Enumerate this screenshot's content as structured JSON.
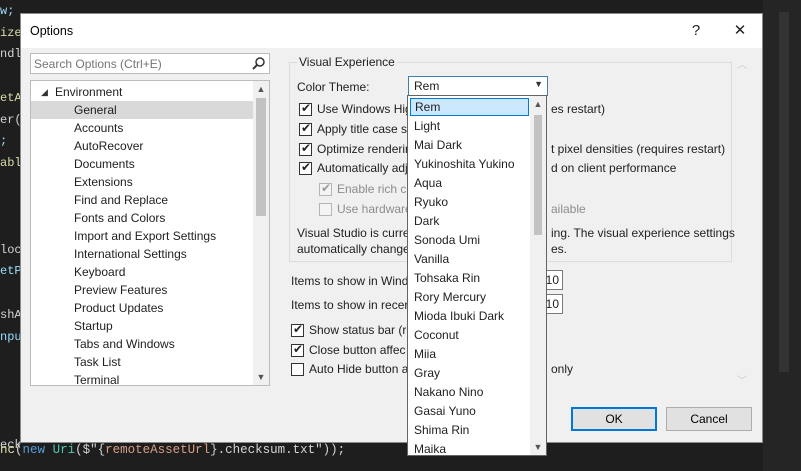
{
  "editor": {
    "left_fragments": [
      "w;",
      "ize",
      "ndl",
      "",
      "etA",
      "er(",
      ";",
      "abl",
      "",
      "",
      "",
      "loc",
      "etP",
      "",
      "shA",
      "npu",
      "",
      "",
      "",
      "",
      "eck"
    ],
    "bottom_line": {
      "fn": "nc",
      "p1": "(",
      "kw": "new",
      "ty": "Uri",
      "p2": "($\"{",
      "st": "remoteAssetUrl",
      "p3": "}.checksum.txt\"));"
    }
  },
  "dialog": {
    "title": "Options",
    "help_label": "?",
    "close_label": "✕",
    "search": {
      "placeholder": "Search Options (Ctrl+E)",
      "value": ""
    },
    "tree": {
      "root": "Environment",
      "items": [
        {
          "label": "General",
          "selected": true
        },
        {
          "label": "Accounts"
        },
        {
          "label": "AutoRecover"
        },
        {
          "label": "Documents"
        },
        {
          "label": "Extensions"
        },
        {
          "label": "Find and Replace"
        },
        {
          "label": "Fonts and Colors"
        },
        {
          "label": "Import and Export Settings"
        },
        {
          "label": "International Settings"
        },
        {
          "label": "Keyboard"
        },
        {
          "label": "Preview Features"
        },
        {
          "label": "Product Updates"
        },
        {
          "label": "Startup"
        },
        {
          "label": "Tabs and Windows"
        },
        {
          "label": "Task List"
        },
        {
          "label": "Terminal"
        }
      ]
    },
    "visual_experience": {
      "group_title": "Visual Experience",
      "color_theme_label": "Color Theme:",
      "color_theme_value": "Rem",
      "checkboxes": [
        {
          "label": "Use Windows Hig",
          "tail": "es restart)",
          "checked": true
        },
        {
          "label": "Apply title case st",
          "tail": "",
          "checked": true
        },
        {
          "label": "Optimize renderin",
          "tail": "t pixel densities (requires restart)",
          "checked": true
        },
        {
          "label": "Automatically adj",
          "tail": "d on client performance",
          "checked": true
        },
        {
          "label": "Enable rich cl",
          "tail": "",
          "checked": true,
          "disabled": true
        },
        {
          "label": "Use hardware",
          "tail": "ailable",
          "checked": false,
          "disabled": true
        }
      ],
      "note_line1_left": "Visual Studio is curre",
      "note_line1_right": "ing.  The visual experience settings",
      "note_line2_left": "automatically change",
      "note_line2_right": "es."
    },
    "items_window_label": "Items to show in Wind",
    "items_window_value": "10",
    "items_recent_label": "Items to show in recer",
    "items_recent_value": "10",
    "status_bar_label": "Show status bar (re",
    "status_bar_checked": true,
    "close_button_label": "Close button affec",
    "close_button_checked": true,
    "autohide_label": "Auto Hide button a",
    "autohide_tail": "only",
    "autohide_checked": false,
    "ok_label": "OK",
    "cancel_label": "Cancel",
    "theme_options": [
      "Rem",
      "Light",
      "Mai Dark",
      "Yukinoshita Yukino",
      "Aqua",
      "Ryuko",
      "Dark",
      "Sonoda Umi",
      "Vanilla",
      "Tohsaka Rin",
      "Rory Mercury",
      "Mioda Ibuki Dark",
      "Coconut",
      "Miia",
      "Gray",
      "Nakano Nino",
      "Gasai Yuno",
      "Shima Rin",
      "Maika"
    ],
    "theme_selected_index": 0
  }
}
